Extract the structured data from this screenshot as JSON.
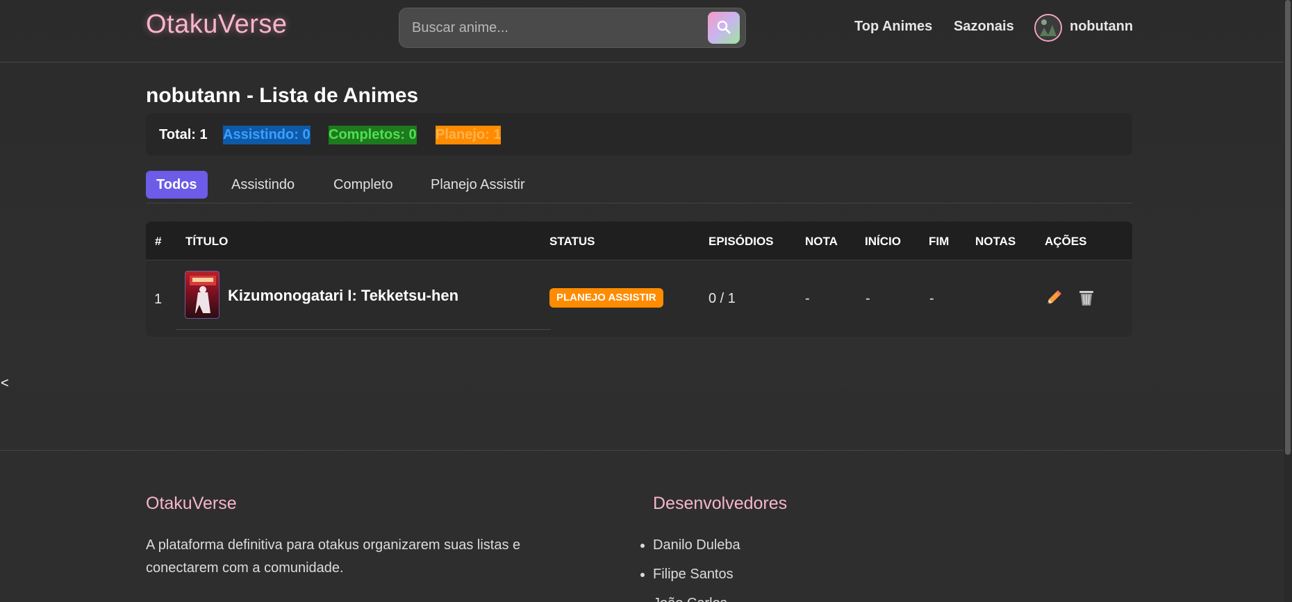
{
  "header": {
    "logo": "OtakuVerse",
    "search_placeholder": "Buscar anime...",
    "nav": [
      "Top Animes",
      "Sazonais"
    ],
    "username": "nobutann"
  },
  "page": {
    "title": "nobutann - Lista de Animes",
    "stats": {
      "total": "Total: 1",
      "assistindo": "Assistindo: 0",
      "completos": "Completos: 0",
      "planejo": "Planejo: 1"
    },
    "tabs": [
      "Todos",
      "Assistindo",
      "Completo",
      "Planejo Assistir"
    ],
    "active_tab": "Todos"
  },
  "table": {
    "headers": [
      "#",
      "TÍTULO",
      "STATUS",
      "EPISÓDIOS",
      "NOTA",
      "INÍCIO",
      "FIM",
      "NOTAS",
      "AÇÕES"
    ],
    "rows": [
      {
        "index": "1",
        "title": "Kizumonogatari I: Tekketsu-hen",
        "status": "PLANEJO ASSISTIR",
        "episodes": "0 / 1",
        "score": "-",
        "start": "-",
        "end": "-",
        "notes": ""
      }
    ]
  },
  "side_arrow": "<",
  "footer": {
    "brand": "OtakuVerse",
    "description": "A plataforma definitiva para otakus organizarem suas listas e conectarem com a comunidade.",
    "devs_title": "Desenvolvedores",
    "devs": [
      "Danilo Duleba",
      "Filipe Santos",
      "João Carlos"
    ]
  },
  "colors": {
    "accent_purple": "#6c5ce7",
    "pink": "#f7b6c9",
    "assistindo_bg": "#0e5aa8",
    "assistindo_fg": "#3aa0ff",
    "completos_bg": "#1e7a1e",
    "completos_fg": "#4fe04f",
    "planejo_bg": "#ff8c00",
    "planejo_fg": "#ffb24d"
  },
  "icons": [
    "search-icon",
    "pencil-icon",
    "trash-icon"
  ]
}
